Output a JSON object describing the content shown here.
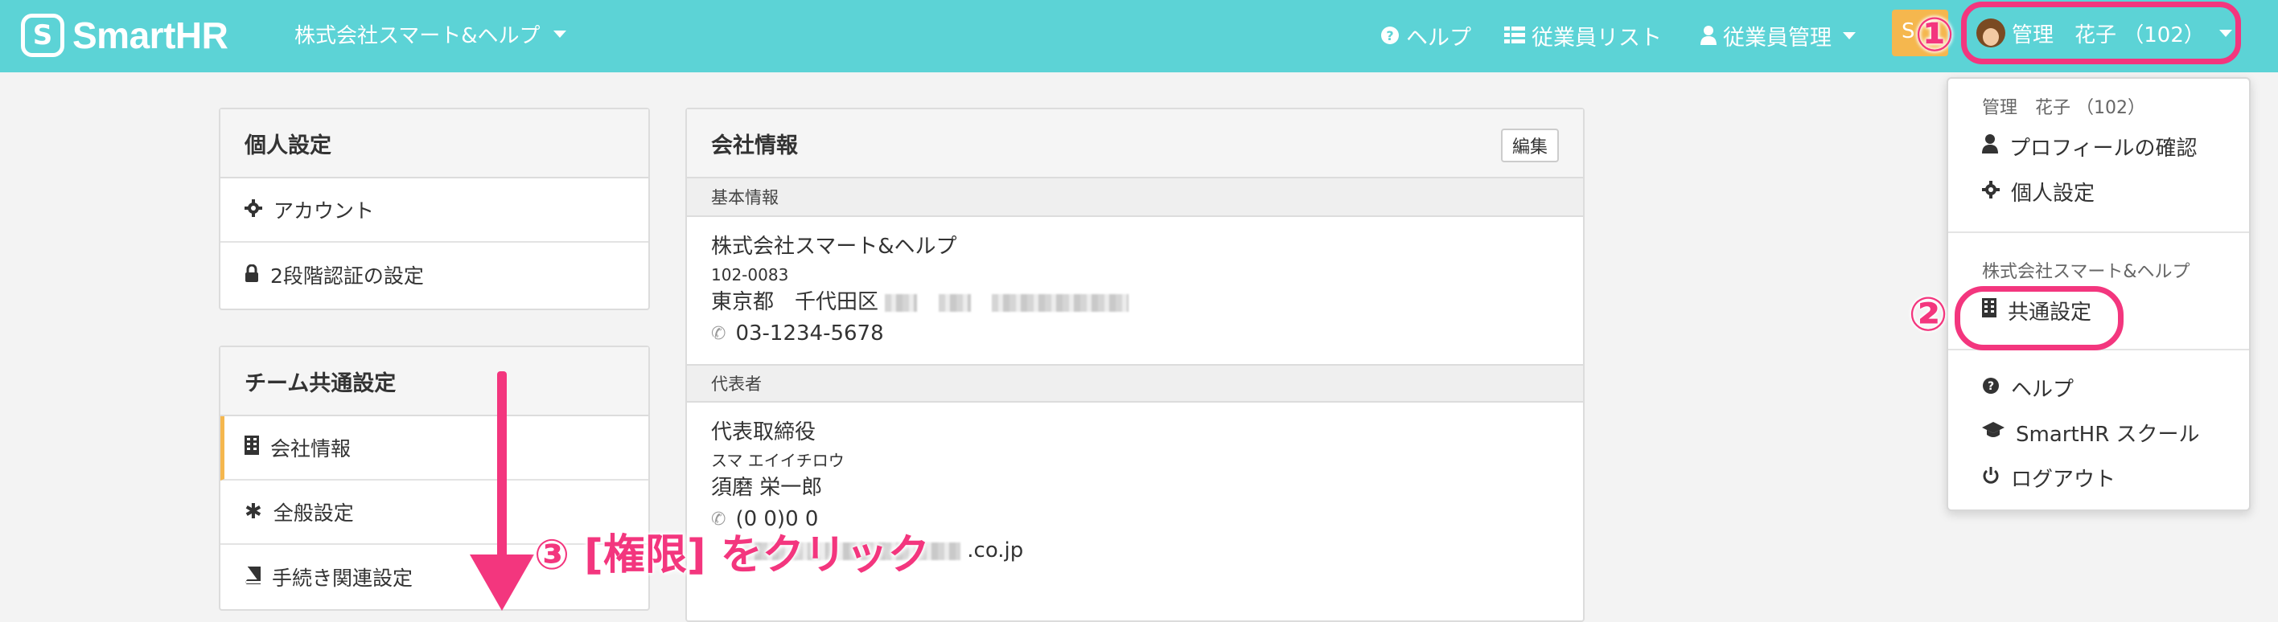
{
  "header": {
    "logo_mark": "S",
    "logo_text": "SmartHR",
    "company_name": "株式会社スマート&ヘルプ",
    "nav": {
      "help": "ヘルプ",
      "employee_list": "従業員リスト",
      "employee_mgmt": "従業員管理"
    },
    "orange_button_text": "S",
    "user_name": "管理　花子 （102）"
  },
  "personal_settings": {
    "title": "個人設定",
    "items": [
      "アカウント",
      "2段階認証の設定"
    ]
  },
  "team_settings": {
    "title": "チーム共通設定",
    "items": [
      "会社情報",
      "全般設定",
      "手続き関連設定"
    ]
  },
  "company_info": {
    "title": "会社情報",
    "edit_label": "編集",
    "basic_section": "基本情報",
    "company_name": "株式会社スマート&ヘルプ",
    "postal_code": "102-0083",
    "address_prefix": "東京都　千代田区",
    "phone": "03-1234-5678",
    "rep_section": "代表者",
    "rep_title": "代表取締役",
    "rep_kana": "スマ エイイチロウ",
    "rep_name": "須磨 栄一郎",
    "rep_phone_partial": "(0 0)0 0",
    "email_suffix": ".co.jp"
  },
  "dropdown": {
    "user_caption": "管理　花子 （102）",
    "profile": "プロフィールの確認",
    "personal": "個人設定",
    "company_caption": "株式会社スマート&ヘルプ",
    "common_settings": "共通設定",
    "help": "ヘルプ",
    "school": "SmartHR スクール",
    "logout": "ログアウト"
  },
  "annotations": {
    "step1": "①",
    "step2": "②",
    "step3": "③ [権限] をクリック"
  },
  "colors": {
    "header_bg": "#5cd3d6",
    "annotation_pink": "#f3367e",
    "active_accent": "#f5b74e"
  }
}
